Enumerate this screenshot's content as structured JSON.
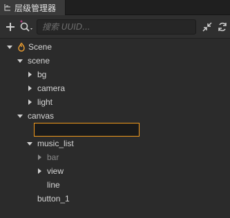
{
  "panel": {
    "title": "层级管理器"
  },
  "toolbar": {
    "add_icon": "plus-icon",
    "search_mode_icon": "search-icon",
    "search_placeholder": "搜索 UUID...",
    "search_value": "",
    "collapse_icon": "collapse-icon",
    "refresh_icon": "refresh-icon"
  },
  "tree": {
    "scene_root": "Scene",
    "scene": "scene",
    "bg": "bg",
    "camera": "camera",
    "light": "light",
    "canvas": "canvas",
    "rename_value": "",
    "music_list": "music_list",
    "bar": "bar",
    "view": "view",
    "line": "line",
    "button_1": "button_1"
  },
  "colors": {
    "background": "#2b2b2b",
    "rename_border": "#f19a1d",
    "scene_icon": "#f0a030"
  }
}
